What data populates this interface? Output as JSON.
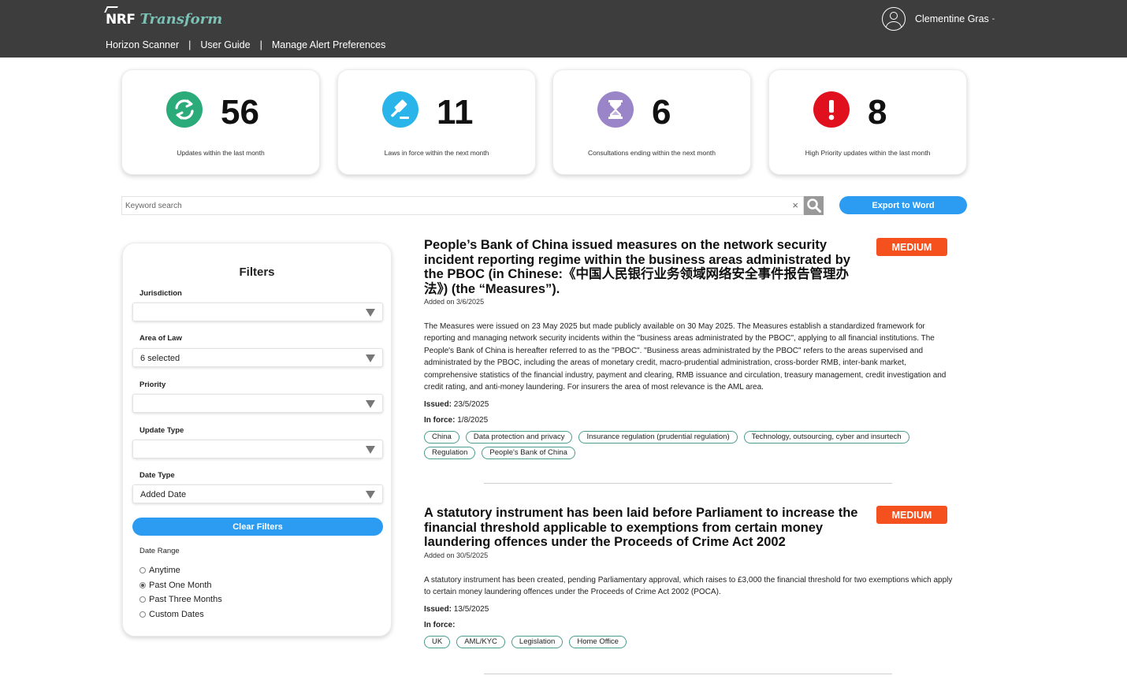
{
  "header": {
    "brand_nrf": "NRF",
    "brand_product": "Transform",
    "nav": [
      "Horizon Scanner",
      "User Guide",
      "Manage Alert Preferences"
    ],
    "nav_separator": "|",
    "user_name": "Clementine Gras",
    "user_dropdown": "-"
  },
  "stats": [
    {
      "value": "56",
      "label": "Updates within the last month",
      "icon": "refresh-icon",
      "color": "#2baa7a"
    },
    {
      "value": "11",
      "label": "Laws in force within the next month",
      "icon": "gavel-icon",
      "color": "#29b4ea"
    },
    {
      "value": "6",
      "label": "Consultations ending within the next month",
      "icon": "hourglass-icon",
      "color": "#9b85c9"
    },
    {
      "value": "8",
      "label": "High Priority updates within the last month",
      "icon": "alert-icon",
      "color": "#e0101f"
    }
  ],
  "search": {
    "placeholder": "Keyword search",
    "clear": "×",
    "export_label": "Export to Word"
  },
  "filters": {
    "title": "Filters",
    "jurisdiction": {
      "label": "Jurisdiction",
      "value": ""
    },
    "area_of_law": {
      "label": "Area of Law",
      "value": "6 selected"
    },
    "priority": {
      "label": "Priority",
      "value": ""
    },
    "update_type": {
      "label": "Update Type",
      "value": ""
    },
    "date_type": {
      "label": "Date Type",
      "value": "Added Date"
    },
    "clear_label": "Clear Filters",
    "date_range_label": "Date Range",
    "date_range_options": [
      "Anytime",
      "Past One Month",
      "Past Three Months",
      "Custom Dates"
    ],
    "date_range_selected": "Past One Month"
  },
  "results": [
    {
      "title": "People’s Bank of China issued measures on the network security incident reporting regime within the business areas administrated by the PBOC (in Chinese:《中国人民银行业务领域网络安全事件报告管理办法》) (the “Measures”).",
      "added": "Added on 3/6/2025",
      "priority": "MEDIUM",
      "body": "The Measures were issued on 23 May 2025 but made publicly available on 30 May 2025. The Measures establish a standardized framework for reporting and managing network security incidents within the \"business areas administrated by the PBOC\", applying to all financial institutions. The People's Bank of China is hereafter referred to as the \"PBOC\". \"Business areas administrated by the PBOC\" refers to the areas supervised and administrated by the PBOC, including the areas of monetary credit, macro-prudential administration, cross-border RMB, inter-bank market, comprehensive statistics of the financial industry, payment and clearing, RMB issuance and circulation, treasury management, credit investigation and credit rating, and anti-money laundering. For insurers the area of most relevance is the AML area.",
      "issued_label": "Issued:",
      "issued": "23/5/2025",
      "inforce_label": "In force:",
      "inforce": "1/8/2025",
      "tags": [
        "China",
        "Data protection and privacy",
        "Insurance regulation (prudential regulation)",
        "Technology, outsourcing, cyber and insurtech",
        "Regulation",
        "People's Bank of China"
      ]
    },
    {
      "title": "A statutory instrument has been laid before Parliament to increase the financial threshold applicable to exemptions from certain money laundering offences under the Proceeds of Crime Act 2002",
      "added": "Added on 30/5/2025",
      "priority": "MEDIUM",
      "body": "A statutory instrument has been created, pending Parliamentary approval, which raises to £3,000 the financial threshold for two exemptions which apply to certain money laundering offences under the Proceeds of Crime Act 2002 (POCA).",
      "issued_label": "Issued:",
      "issued": "13/5/2025",
      "inforce_label": "In force:",
      "inforce": "",
      "tags": [
        "UK",
        "AML/KYC",
        "Legislation",
        "Home Office"
      ]
    }
  ]
}
